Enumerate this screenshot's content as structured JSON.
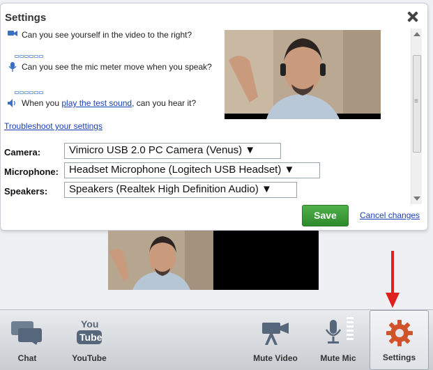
{
  "dialog": {
    "title": "Settings",
    "checks": [
      {
        "icon": "camera-icon",
        "text": "Can you see yourself in the video to the right?"
      },
      {
        "icon": "microphone-icon",
        "text": "Can you see the mic meter move when you speak?"
      },
      {
        "icon": "speaker-icon",
        "text_before": "When you ",
        "link": "play the test sound",
        "text_after": ", can you hear it?"
      }
    ],
    "troubleshoot_link": "Troubleshoot your settings",
    "fields": {
      "camera": {
        "label": "Camera:",
        "value": "Vimicro USB 2.0 PC Camera (Venus) ▼"
      },
      "microphone": {
        "label": "Microphone:",
        "value": "Headset Microphone (Logitech USB Headset) ▼"
      },
      "speakers": {
        "label": "Speakers:",
        "value": "Speakers (Realtek High Definition Audio) ▼"
      }
    },
    "save_label": "Save",
    "cancel_label": "Cancel changes"
  },
  "toolbar": {
    "items": [
      {
        "id": "chat",
        "label": "Chat",
        "icon": "chat-icon"
      },
      {
        "id": "youtube",
        "label": "YouTube",
        "icon": "youtube-icon"
      },
      {
        "id": "mute-video",
        "label": "Mute Video",
        "icon": "video-camera-icon"
      },
      {
        "id": "mute-mic",
        "label": "Mute Mic",
        "icon": "microphone-icon"
      },
      {
        "id": "settings",
        "label": "Settings",
        "icon": "gear-icon",
        "active": true
      }
    ]
  },
  "colors": {
    "accent_green": "#3a9b36",
    "link_blue": "#1a3fb8",
    "arrow_red": "#e0201c"
  }
}
